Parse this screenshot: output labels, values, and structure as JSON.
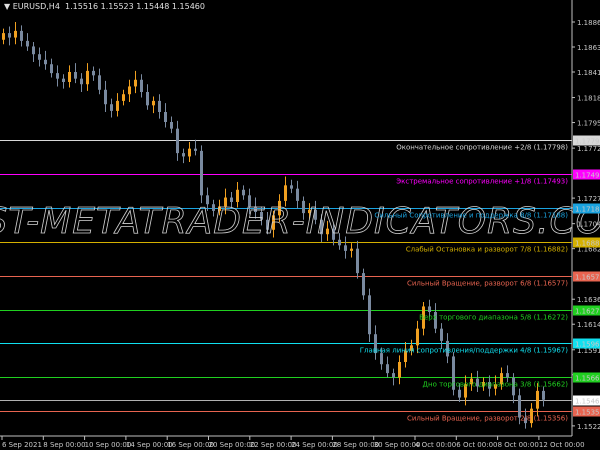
{
  "header": {
    "symbol": "EURUSD,H4",
    "ohlc": "1.15516 1.15523 1.15448 1.15460",
    "menu_icon": "triangle-down-icon"
  },
  "watermark": "BEST-METATRADER-INDICATORS.COM",
  "chart_data": {
    "type": "candlestick",
    "symbol": "EURUSD",
    "timeframe": "H4",
    "ylim": [
      1.1512,
      1.1905
    ],
    "y_ticks": [
      "1.18860",
      "1.18635",
      "1.18410",
      "1.18180",
      "1.17955",
      "1.17725",
      "1.17275",
      "1.17045",
      "1.16820",
      "1.16365",
      "1.16140",
      "1.15910",
      "1.15685",
      "1.15225"
    ],
    "x_ticks": [
      "6 Sep 2021",
      "8 Sep 00:00",
      "10 Sep 00:00",
      "14 Sep 00:00",
      "16 Sep 00:00",
      "20 Sep 00:00",
      "22 Sep 00:00",
      "24 Sep 00:00",
      "28 Sep 00:00",
      "30 Sep 00:00",
      "4 Oct 00:00",
      "6 Oct 00:00",
      "8 Oct 00:00",
      "12 Oct 00:00"
    ],
    "first_open": 1.187,
    "close": [
      1.1876,
      1.1872,
      1.1878,
      1.1869,
      1.1864,
      1.1857,
      1.1852,
      1.1848,
      1.184,
      1.1835,
      1.1832,
      1.1841,
      1.1835,
      1.183,
      1.1842,
      1.1838,
      1.1825,
      1.1812,
      1.1806,
      1.1815,
      1.1821,
      1.1828,
      1.1834,
      1.1823,
      1.1811,
      1.1815,
      1.1805,
      1.1796,
      1.179,
      1.1768,
      1.1765,
      1.1772,
      1.177,
      1.173,
      1.1722,
      1.1716,
      1.172,
      1.1728,
      1.1724,
      1.1735,
      1.173,
      1.172,
      1.1715,
      1.1708,
      1.1699,
      1.1712,
      1.1725,
      1.1739,
      1.1736,
      1.1725,
      1.1714,
      1.1717,
      1.1708,
      1.1695,
      1.17,
      1.169,
      1.1685,
      1.168,
      1.1682,
      1.166,
      1.164,
      1.1605,
      1.1588,
      1.1578,
      1.157,
      1.1566,
      1.158,
      1.159,
      1.1595,
      1.161,
      1.163,
      1.1625,
      1.161,
      1.1599,
      1.1585,
      1.1555,
      1.1548,
      1.156,
      1.1565,
      1.1558,
      1.1562,
      1.1556,
      1.156,
      1.157,
      1.1566,
      1.155,
      1.153,
      1.1525,
      1.1538,
      1.1554,
      1.1546
    ],
    "bull_color": "#f0a020",
    "bear_color": "#7a8aa0",
    "current_price": {
      "value": 1.1546,
      "label": "1.15460",
      "color": "#b0b0b0"
    },
    "levels": [
      {
        "value": 1.17798,
        "label": "1.17798",
        "text": "Окончательное сопротивление +2/8  (1.17798)",
        "color": "#d8d8d8"
      },
      {
        "value": 1.17493,
        "label": "1.17493",
        "text": "Экстремальное сопротивление +1/8  (1.17493)",
        "color": "#ff00ff"
      },
      {
        "value": 1.17188,
        "label": "1.17188",
        "text": "Сильный  Сопротивление и поддержка 8/8  (1.17188)",
        "color": "#1aa3e0"
      },
      {
        "value": 1.16882,
        "label": "1.16882",
        "text": "Слабый  Остановка и разворот 7/8  (1.16882)",
        "color": "#d4b000"
      },
      {
        "value": 1.16577,
        "label": "1.16577",
        "text": "Сильный  Вращение, разворот 6/8  (1.16577)",
        "color": "#e86450"
      },
      {
        "value": 1.16272,
        "label": "1.16272",
        "text": "Верх торгового диапазона 5/8  (1.16272)",
        "color": "#20d020"
      },
      {
        "value": 1.15967,
        "label": "1.15967",
        "text": "Главная линия сопротивления/поддержки 4/8  (1.15967)",
        "color": "#10e0f0"
      },
      {
        "value": 1.15662,
        "label": "1.15662",
        "text": "Дно торгового диапазона 3/8  (1.15662)",
        "color": "#20d020"
      },
      {
        "value": 1.15356,
        "label": "1.15356",
        "text": "Сильный  Вращение, разворот 2/8  (1.15356)",
        "color": "#e86450"
      }
    ]
  }
}
